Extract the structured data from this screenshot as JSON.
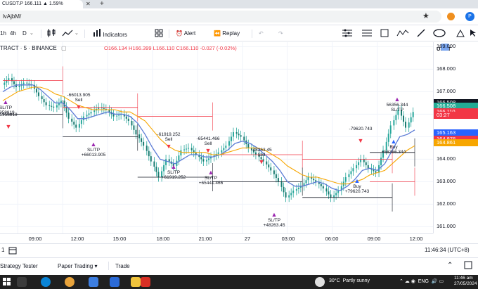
{
  "browser": {
    "tab_title": "CUSDT.P 166.111 ▲ 1.59%",
    "url": "lvAjbM/",
    "close_glyph": "✕",
    "plus_glyph": "+"
  },
  "toolbar": {
    "intervals": [
      "1h",
      "4h",
      "D"
    ],
    "indicators_label": "Indicators",
    "alert_label": "Alert",
    "replay_label": "Replay"
  },
  "legend": {
    "symbol": "TRACT · 5 · BINANCE",
    "o": "O166.134",
    "h": "H166.399",
    "l": "L166.110",
    "c": "C166.110",
    "change": "-0.027 (-0.02%)"
  },
  "price_axis": {
    "currency": "USDT",
    "ticks": [
      "169.000",
      "168.000",
      "167.000",
      "166.000",
      "165.000",
      "164.000",
      "163.000",
      "162.000",
      "161.000"
    ],
    "labels": [
      {
        "text": "166.508",
        "color": "#131722"
      },
      {
        "text": "166.508",
        "color": "#22ab94"
      },
      {
        "text": "166.110",
        "color": "#f23645"
      },
      {
        "text": "03:27",
        "color": "#f23645"
      },
      {
        "text": "165.163",
        "color": "#2962ff"
      },
      {
        "text": "164.876",
        "color": "#f23645"
      },
      {
        "text": "164.861",
        "color": "#f7a600"
      }
    ]
  },
  "time_axis": {
    "ticks": [
      "09:00",
      "12:00",
      "15:00",
      "18:00",
      "21:00",
      "27",
      "03:00",
      "06:00",
      "09:00",
      "12:00"
    ]
  },
  "annotations": [
    {
      "text": "-66013.905\nSell",
      "kind": "sell"
    },
    {
      "text": "SL/TP\n+66013.905",
      "kind": "tp"
    },
    {
      "text": "-61919.252\nSell",
      "kind": "sell"
    },
    {
      "text": "SL/TP\n+61919.252",
      "kind": "tp"
    },
    {
      "text": "-65441.466\nSell",
      "kind": "sell"
    },
    {
      "text": "SL/TP\n+65441.466",
      "kind": "tp"
    },
    {
      "text": "-48263.45\nSell",
      "kind": "sell"
    },
    {
      "text": "SL/TP\n+48263.45",
      "kind": "tp"
    },
    {
      "text": "-79620.743",
      "kind": "sell"
    },
    {
      "text": "Buy\n+79620.743",
      "kind": "buy"
    },
    {
      "text": "56356.344\nSL/TP",
      "kind": "tp"
    },
    {
      "text": "Buy\n+56356.344",
      "kind": "buy"
    },
    {
      "text": "SL/TP\n1958819",
      "kind": "tp"
    },
    {
      "text": "5958819",
      "kind": "sell"
    }
  ],
  "chart_data": {
    "type": "line",
    "x": [
      "08:00",
      "08:30",
      "09:00",
      "09:30",
      "10:00",
      "10:30",
      "11:00",
      "11:30",
      "12:00",
      "12:30",
      "13:00",
      "13:30",
      "14:00",
      "14:30",
      "15:00",
      "15:30",
      "16:00",
      "16:30",
      "17:00",
      "17:30",
      "18:00",
      "18:30",
      "19:00",
      "19:30",
      "20:00",
      "20:30",
      "21:00",
      "21:30",
      "22:00",
      "22:30",
      "23:00",
      "23:30",
      "00:00",
      "00:30",
      "01:00",
      "01:30",
      "02:00",
      "02:30",
      "03:00",
      "03:30",
      "04:00",
      "04:30",
      "05:00",
      "05:30",
      "06:00",
      "06:30",
      "07:00",
      "07:30",
      "08:00",
      "08:30",
      "09:00",
      "09:30",
      "10:00",
      "10:30",
      "11:00",
      "11:30"
    ],
    "series": [
      {
        "values": [
          167.3,
          167.6,
          167.2,
          167.4,
          167.3,
          166.8,
          166.4,
          166.3,
          166.6,
          165.8,
          165.4,
          165.9,
          166.1,
          166.3,
          166.2,
          165.9,
          166.0,
          165.7,
          165.1,
          164.6,
          163.9,
          163.2,
          164.0,
          163.7,
          164.4,
          164.5,
          164.2,
          163.9,
          164.1,
          164.3,
          164.6,
          165.2,
          165.0,
          164.5,
          164.2,
          163.9,
          163.5,
          163.0,
          162.3,
          162.6,
          162.8,
          163.2,
          163.0,
          162.7,
          162.3,
          162.6,
          163.2,
          163.6,
          164.0,
          163.6,
          163.4,
          164.4,
          165.5,
          166.2,
          165.4,
          166.1
        ]
      },
      {
        "values": [
          167.0,
          167.2,
          167.3,
          167.3,
          167.3,
          167.1,
          166.8,
          166.5,
          166.5,
          166.2,
          165.8,
          165.8,
          165.9,
          166.0,
          166.1,
          166.0,
          166.0,
          165.9,
          165.6,
          165.1,
          164.5,
          164.0,
          163.9,
          163.8,
          164.0,
          164.2,
          164.2,
          164.1,
          164.1,
          164.2,
          164.4,
          164.7,
          164.8,
          164.7,
          164.5,
          164.2,
          163.9,
          163.5,
          163.0,
          162.8,
          162.8,
          162.9,
          163.0,
          162.9,
          162.7,
          162.6,
          162.8,
          163.1,
          163.5,
          163.6,
          163.5,
          163.8,
          164.4,
          165.0,
          165.1,
          165.3
        ]
      },
      {
        "values": [
          166.6,
          166.8,
          167.0,
          167.1,
          167.2,
          167.2,
          167.1,
          166.9,
          166.8,
          166.6,
          166.4,
          166.3,
          166.2,
          166.2,
          166.2,
          166.2,
          166.1,
          166.1,
          165.9,
          165.7,
          165.3,
          164.9,
          164.6,
          164.4,
          164.3,
          164.3,
          164.3,
          164.3,
          164.2,
          164.2,
          164.3,
          164.4,
          164.5,
          164.5,
          164.5,
          164.4,
          164.2,
          164.0,
          163.7,
          163.5,
          163.3,
          163.2,
          163.2,
          163.1,
          163.0,
          162.9,
          162.9,
          163.0,
          163.1,
          163.3,
          163.4,
          163.5,
          163.8,
          164.1,
          164.4,
          164.6
        ]
      }
    ],
    "ylim": [
      160.7,
      169.2
    ],
    "grid": true,
    "colors": {
      "price": "#2962ff",
      "fast_ma": "#5b7bd5",
      "slow_ma": "#f7a600",
      "candle_up": "#26a69a",
      "candle_down": "#26a69a",
      "levels": "#131722",
      "stop": "#f23645"
    }
  }
}
